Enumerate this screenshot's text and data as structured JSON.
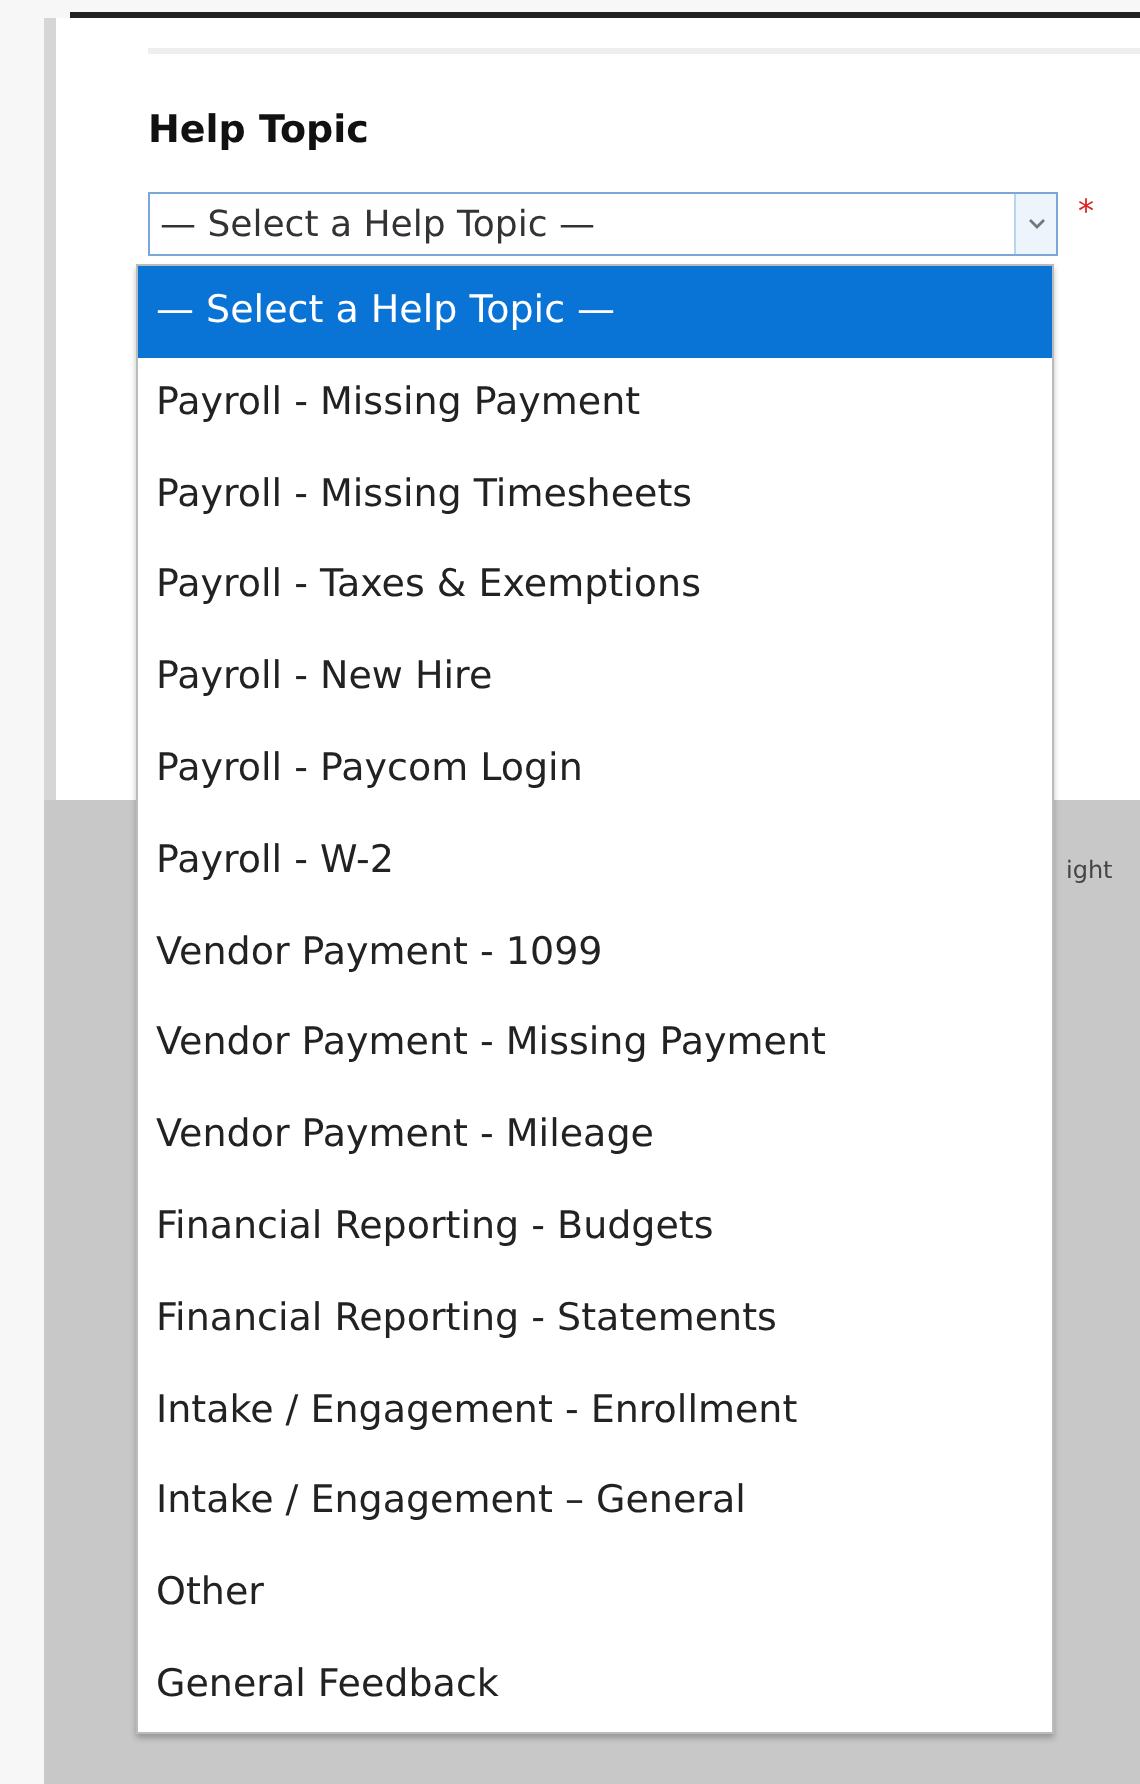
{
  "field": {
    "label": "Help Topic",
    "value": "— Select a Help Topic —",
    "required_mark": "*",
    "expanded": true
  },
  "options": [
    {
      "label": "— Select a Help Topic —",
      "selected": true
    },
    {
      "label": "Payroll - Missing Payment",
      "selected": false
    },
    {
      "label": "Payroll - Missing Timesheets",
      "selected": false
    },
    {
      "label": "Payroll - Taxes & Exemptions",
      "selected": false
    },
    {
      "label": "Payroll - New Hire",
      "selected": false
    },
    {
      "label": "Payroll - Paycom Login",
      "selected": false
    },
    {
      "label": "Payroll - W-2",
      "selected": false
    },
    {
      "label": "Vendor Payment - 1099",
      "selected": false
    },
    {
      "label": "Vendor Payment - Missing Payment",
      "selected": false
    },
    {
      "label": "Vendor Payment - Mileage",
      "selected": false
    },
    {
      "label": "Financial Reporting - Budgets",
      "selected": false
    },
    {
      "label": "Financial Reporting - Statements",
      "selected": false
    },
    {
      "label": "Intake / Engagement - Enrollment",
      "selected": false
    },
    {
      "label": "Intake / Engagement – General",
      "selected": false
    },
    {
      "label": "Other",
      "selected": false
    },
    {
      "label": "General Feedback",
      "selected": false
    }
  ],
  "footer": {
    "text": "ight"
  }
}
